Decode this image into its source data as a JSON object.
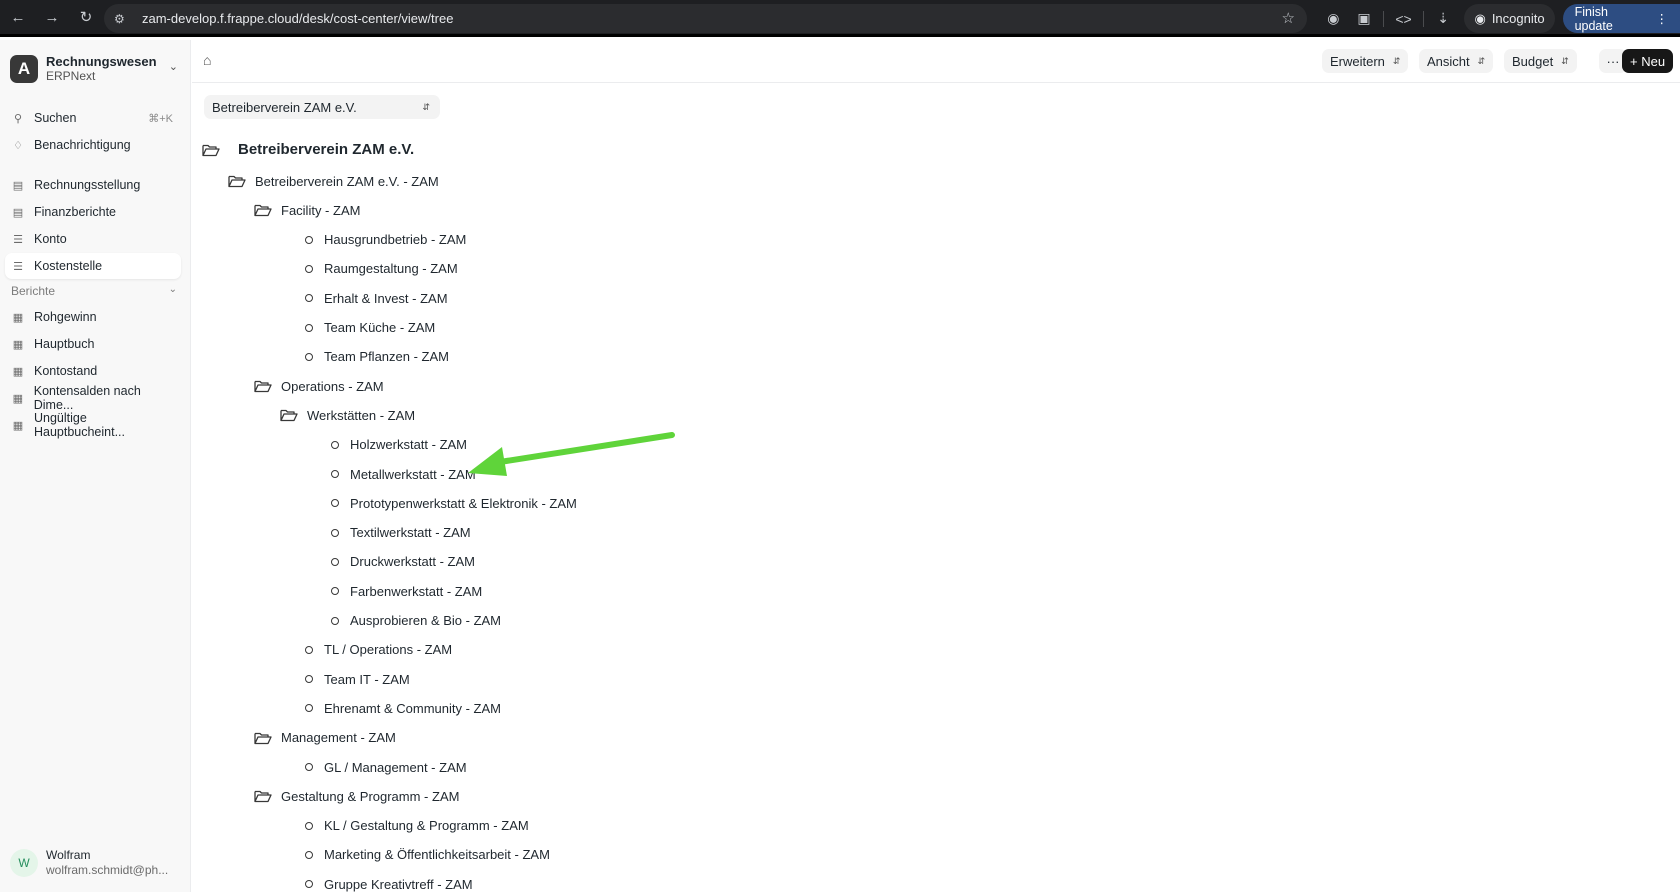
{
  "browser": {
    "url": "zam-develop.f.frappe.cloud/desk/cost-center/view/tree",
    "incognito_label": "Incognito",
    "finish_update_label": "Finish update"
  },
  "sidebar": {
    "workspace": {
      "logo_letter": "A",
      "title": "Rechnungswesen",
      "subtitle": "ERPNext"
    },
    "search": {
      "label": "Suchen",
      "shortcut": "⌘+K"
    },
    "notifications_label": "Benachrichtigung",
    "items": [
      {
        "label": "Rechnungsstellung",
        "icon": "chart-icon"
      },
      {
        "label": "Finanzberichte",
        "icon": "chart-icon"
      },
      {
        "label": "Konto",
        "icon": "list-icon"
      },
      {
        "label": "Kostenstelle",
        "icon": "list-icon",
        "active": true
      }
    ],
    "section_label": "Berichte",
    "reports": [
      {
        "label": "Rohgewinn"
      },
      {
        "label": "Hauptbuch"
      },
      {
        "label": "Kontostand"
      },
      {
        "label": "Kontensalden nach Dime..."
      },
      {
        "label": "Ungültige Hauptbucheint..."
      }
    ],
    "user": {
      "initial": "W",
      "name": "Wolfram",
      "email": "wolfram.schmidt@ph..."
    }
  },
  "toolbar": {
    "expand_label": "Erweitern",
    "view_label": "Ansicht",
    "budget_label": "Budget",
    "more_label": "···",
    "new_label": "+ Neu"
  },
  "company_filter": {
    "value": "Betreiberverein ZAM e.V."
  },
  "tree": {
    "root": "Betreiberverein ZAM e.V.",
    "nodes": [
      {
        "label": "Betreiberverein ZAM e.V. - ZAM",
        "type": "group",
        "depth": 1
      },
      {
        "label": "Facility - ZAM",
        "type": "group",
        "depth": 2
      },
      {
        "label": "Hausgrundbetrieb - ZAM",
        "type": "leaf",
        "depth": 3
      },
      {
        "label": "Raumgestaltung - ZAM",
        "type": "leaf",
        "depth": 3
      },
      {
        "label": "Erhalt & Invest - ZAM",
        "type": "leaf",
        "depth": 3
      },
      {
        "label": "Team Küche - ZAM",
        "type": "leaf",
        "depth": 3
      },
      {
        "label": "Team Pflanzen - ZAM",
        "type": "leaf",
        "depth": 3
      },
      {
        "label": "Operations - ZAM",
        "type": "group",
        "depth": 2
      },
      {
        "label": "Werkstätten - ZAM",
        "type": "group",
        "depth": 3
      },
      {
        "label": "Holzwerkstatt - ZAM",
        "type": "leaf",
        "depth": 4
      },
      {
        "label": "Metallwerkstatt - ZAM",
        "type": "leaf",
        "depth": 4
      },
      {
        "label": "Prototypenwerkstatt & Elektronik - ZAM",
        "type": "leaf",
        "depth": 4
      },
      {
        "label": "Textilwerkstatt - ZAM",
        "type": "leaf",
        "depth": 4
      },
      {
        "label": "Druckwerkstatt - ZAM",
        "type": "leaf",
        "depth": 4
      },
      {
        "label": "Farbenwerkstatt - ZAM",
        "type": "leaf",
        "depth": 4
      },
      {
        "label": "Ausprobieren & Bio - ZAM",
        "type": "leaf",
        "depth": 4
      },
      {
        "label": "TL / Operations - ZAM",
        "type": "leaf",
        "depth": 3
      },
      {
        "label": "Team IT - ZAM",
        "type": "leaf",
        "depth": 3
      },
      {
        "label": "Ehrenamt & Community - ZAM",
        "type": "leaf",
        "depth": 3
      },
      {
        "label": "Management - ZAM",
        "type": "group",
        "depth": 2
      },
      {
        "label": "GL / Management - ZAM",
        "type": "leaf",
        "depth": 3
      },
      {
        "label": "Gestaltung & Programm - ZAM",
        "type": "group",
        "depth": 2
      },
      {
        "label": "KL / Gestaltung & Programm - ZAM",
        "type": "leaf",
        "depth": 3
      },
      {
        "label": "Marketing & Öffentlichkeitsarbeit - ZAM",
        "type": "leaf",
        "depth": 3
      },
      {
        "label": "Gruppe Kreativtreff - ZAM",
        "type": "leaf",
        "depth": 3
      }
    ]
  },
  "annotation": {
    "arrow_color": "#5fd43a"
  },
  "colors": {
    "accent_dark": "#171717",
    "finish_update_bg": "#2d4d82"
  }
}
